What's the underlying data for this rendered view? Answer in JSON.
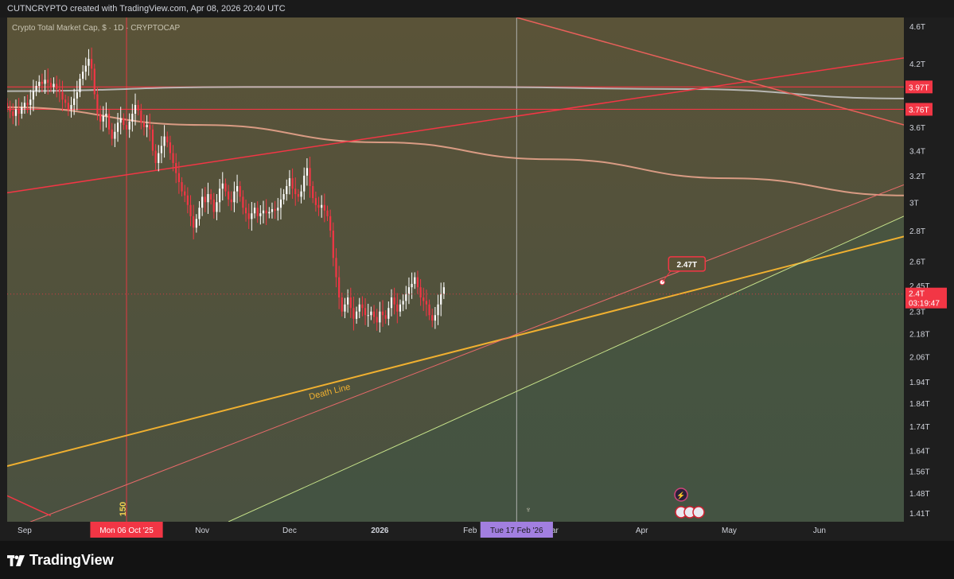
{
  "header": {
    "credit": "CUTNCRYPTO created with TradingView.com, Apr 08, 2026 20:40 UTC"
  },
  "brand": {
    "name": "TradingView"
  },
  "colors": {
    "bg_upper": "#5a5338",
    "bg_lower": "#48543f",
    "candle_up": "#ffffff",
    "candle_down": "#f23645",
    "red_line": "#f23645",
    "death_line": "#f0b030",
    "green_line": "#c6e28a",
    "grey_curve": "#c8c8c8",
    "salmon_curve": "#f0a890",
    "date_crosshair": "#a27fe0"
  },
  "chart_data": {
    "type": "candlestick",
    "title": "Crypto Total Market Cap, $ · 1D · CRYPTOCAP",
    "y_scale": "log",
    "ylim": [
      1.38,
      4.7
    ],
    "y_ticks": [
      "4.6T",
      "4.2T",
      "3.6T",
      "3.4T",
      "3.2T",
      "3T",
      "2.8T",
      "2.6T",
      "2.45T",
      "2.3T",
      "2.18T",
      "2.06T",
      "1.94T",
      "1.84T",
      "1.74T",
      "1.64T",
      "1.56T",
      "1.48T",
      "1.41T"
    ],
    "x_range": [
      "2025-08-26",
      "2026-06-30"
    ],
    "x_ticks": [
      {
        "label": "Sep",
        "date": "2025-09-01"
      },
      {
        "label": "Nov",
        "date": "2025-11-01"
      },
      {
        "label": "Dec",
        "date": "2025-12-01"
      },
      {
        "label": "2026",
        "date": "2026-01-01"
      },
      {
        "label": "Feb",
        "date": "2026-02-01"
      },
      {
        "label": "Mar",
        "date": "2026-03-01"
      },
      {
        "label": "Apr",
        "date": "2026-04-01"
      },
      {
        "label": "May",
        "date": "2026-05-01"
      },
      {
        "label": "Jun",
        "date": "2026-06-01"
      }
    ],
    "price_levels": [
      {
        "label": "3.97T",
        "value": 3.97
      },
      {
        "label": "3.76T",
        "value": 3.76
      }
    ],
    "current_price": {
      "label": "2.4T",
      "countdown": "03:19:47",
      "value": 2.4
    },
    "callout": {
      "label": "2.47T",
      "value": 2.47,
      "date": "2026-04-08"
    },
    "vertical_markers": [
      {
        "date": "2025-10-06",
        "label": "Mon 06 Oct '25",
        "side_text": "150"
      },
      {
        "date": "2026-02-17",
        "label": "Tue 17 Feb '26"
      }
    ],
    "annotations": [
      {
        "text": "Death Line"
      }
    ],
    "trend_lines": [
      {
        "kind": "death_line",
        "points": [
          [
            "2025-08-26",
            1.58
          ],
          [
            "2026-06-30",
            2.76
          ]
        ]
      },
      {
        "kind": "red_rising",
        "points": [
          [
            "2025-08-26",
            3.07
          ],
          [
            "2026-06-30",
            4.26
          ]
        ]
      },
      {
        "kind": "red_falling",
        "points": [
          [
            "2026-02-17",
            4.7
          ],
          [
            "2026-06-30",
            3.62
          ]
        ]
      },
      {
        "kind": "red_lower_channel",
        "points": [
          [
            "2025-08-26",
            1.35
          ],
          [
            "2026-06-30",
            3.13
          ]
        ]
      },
      {
        "kind": "green_support",
        "points": [
          [
            "2025-11-10",
            1.38
          ],
          [
            "2026-06-30",
            2.9
          ]
        ]
      }
    ],
    "curves": [
      {
        "kind": "grey_arc",
        "points": [
          [
            "2025-08-26",
            3.93
          ],
          [
            "2025-11-15",
            3.97
          ],
          [
            "2026-02-01",
            3.97
          ],
          [
            "2026-04-15",
            3.95
          ],
          [
            "2026-06-30",
            3.86
          ]
        ]
      },
      {
        "kind": "salmon_arc",
        "points": [
          [
            "2025-08-26",
            3.78
          ],
          [
            "2025-11-01",
            3.62
          ],
          [
            "2026-01-01",
            3.47
          ],
          [
            "2026-03-01",
            3.33
          ],
          [
            "2026-05-01",
            3.18
          ],
          [
            "2026-06-30",
            3.05
          ]
        ]
      }
    ],
    "series": [
      {
        "name": "Crypto Total Market Cap",
        "close": [
          3.78,
          3.74,
          3.7,
          3.76,
          3.72,
          3.78,
          3.82,
          3.8,
          3.85,
          3.93,
          3.98,
          4.02,
          4.0,
          4.04,
          4.01,
          3.97,
          4.0,
          3.95,
          3.92,
          3.85,
          3.82,
          3.76,
          3.8,
          3.86,
          3.92,
          4.05,
          4.12,
          4.18,
          4.25,
          4.15,
          3.9,
          3.72,
          3.65,
          3.7,
          3.72,
          3.58,
          3.5,
          3.56,
          3.64,
          3.68,
          3.62,
          3.58,
          3.65,
          3.72,
          3.8,
          3.75,
          3.64,
          3.6,
          3.62,
          3.58,
          3.4,
          3.3,
          3.38,
          3.44,
          3.52,
          3.47,
          3.38,
          3.3,
          3.22,
          3.15,
          3.08,
          3.05,
          2.98,
          2.9,
          2.82,
          2.88,
          2.96,
          3.04,
          3.0,
          3.06,
          3.02,
          2.93,
          3.0,
          3.1,
          3.14,
          3.08,
          3.02,
          3.0,
          3.08,
          3.12,
          3.04,
          2.96,
          2.92,
          2.88,
          2.92,
          2.96,
          2.9,
          2.92,
          2.94,
          2.92,
          2.93,
          2.95,
          2.94,
          2.96,
          3.02,
          3.06,
          3.12,
          3.18,
          3.1,
          3.06,
          3.04,
          3.08,
          3.2,
          3.26,
          3.12,
          3.03,
          2.98,
          2.96,
          2.98,
          2.94,
          2.9,
          2.8,
          2.62,
          2.5,
          2.38,
          2.3,
          2.34,
          2.38,
          2.32,
          2.26,
          2.3,
          2.34,
          2.32,
          2.28,
          2.28,
          2.3,
          2.27,
          2.24,
          2.3,
          2.28,
          2.26,
          2.32,
          2.38,
          2.34,
          2.3,
          2.34,
          2.36,
          2.4,
          2.44,
          2.46,
          2.5,
          2.44,
          2.38,
          2.36,
          2.34,
          2.28,
          2.25,
          2.28,
          2.34,
          2.4,
          2.44
        ]
      }
    ]
  }
}
